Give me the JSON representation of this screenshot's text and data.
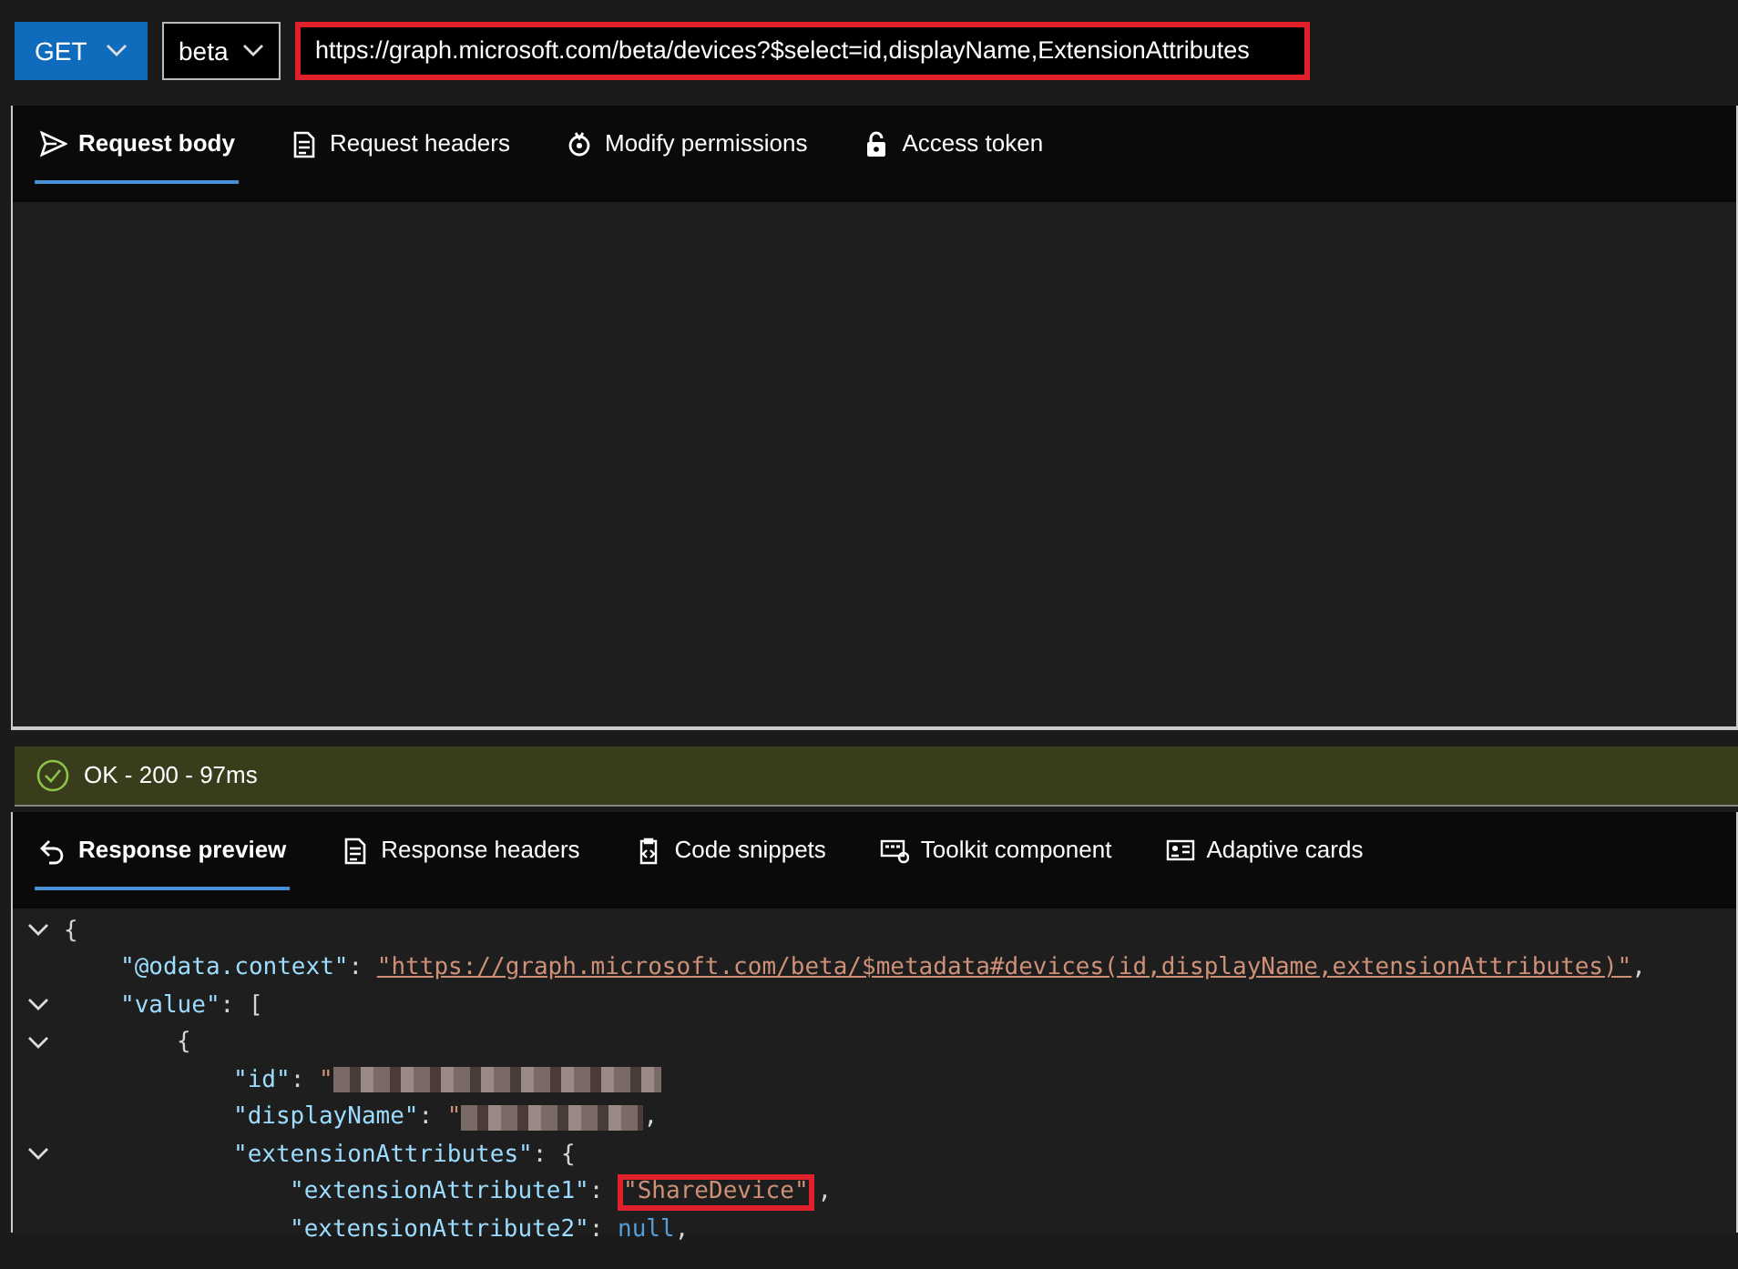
{
  "query_bar": {
    "method": "GET",
    "version": "beta",
    "url": "https://graph.microsoft.com/beta/devices?$select=id,displayName,ExtensionAttributes",
    "url_highlighted": true
  },
  "request_tabs": [
    {
      "label": "Request body",
      "selected": true
    },
    {
      "label": "Request headers",
      "selected": false
    },
    {
      "label": "Modify permissions",
      "selected": false
    },
    {
      "label": "Access token",
      "selected": false
    }
  ],
  "status": {
    "text": "OK - 200 - 97ms",
    "kind": "success"
  },
  "response_tabs": [
    {
      "label": "Response preview",
      "selected": true
    },
    {
      "label": "Response headers",
      "selected": false
    },
    {
      "label": "Code snippets",
      "selected": false
    },
    {
      "label": "Toolkit component",
      "selected": false
    },
    {
      "label": "Adaptive cards",
      "selected": false
    }
  ],
  "response_code": [
    {
      "foldable": true,
      "tokens": [
        {
          "kind": "punct",
          "text": "{"
        }
      ],
      "children": [
        {
          "foldable": false,
          "tokens": [
            {
              "kind": "key",
              "text": "\"@odata.context\""
            },
            {
              "kind": "punct",
              "text": ": "
            },
            {
              "kind": "link",
              "text": "\"https://graph.microsoft.com/beta/$metadata#devices(id,displayName,extensionAttributes)\""
            },
            {
              "kind": "punct",
              "text": ","
            }
          ]
        },
        {
          "foldable": true,
          "tokens": [
            {
              "kind": "key",
              "text": "\"value\""
            },
            {
              "kind": "punct",
              "text": ": ["
            }
          ],
          "children": [
            {
              "foldable": true,
              "tokens": [
                {
                  "kind": "punct",
                  "text": "{"
                }
              ],
              "children": [
                {
                  "foldable": false,
                  "tokens": [
                    {
                      "kind": "key",
                      "text": "\"id\""
                    },
                    {
                      "kind": "punct",
                      "text": ": "
                    },
                    {
                      "kind": "string",
                      "text": "\""
                    },
                    {
                      "kind": "redacted"
                    }
                  ]
                },
                {
                  "foldable": false,
                  "tokens": [
                    {
                      "kind": "key",
                      "text": "\"displayName\""
                    },
                    {
                      "kind": "punct",
                      "text": ": "
                    },
                    {
                      "kind": "string",
                      "text": "\""
                    },
                    {
                      "kind": "redacted"
                    },
                    {
                      "kind": "punct",
                      "text": ","
                    }
                  ]
                },
                {
                  "foldable": true,
                  "tokens": [
                    {
                      "kind": "key",
                      "text": "\"extensionAttributes\""
                    },
                    {
                      "kind": "punct",
                      "text": ": {"
                    }
                  ],
                  "children": [
                    {
                      "foldable": false,
                      "tokens": [
                        {
                          "kind": "key",
                          "text": "\"extensionAttribute1\""
                        },
                        {
                          "kind": "punct",
                          "text": ": "
                        },
                        {
                          "kind": "string",
                          "text": "\"ShareDevice\"",
                          "highlighted": true
                        },
                        {
                          "kind": "punct",
                          "text": ","
                        }
                      ]
                    },
                    {
                      "foldable": false,
                      "tokens": [
                        {
                          "kind": "key",
                          "text": "\"extensionAttribute2\""
                        },
                        {
                          "kind": "punct",
                          "text": ": "
                        },
                        {
                          "kind": "null",
                          "text": "null"
                        },
                        {
                          "kind": "punct",
                          "text": ","
                        }
                      ]
                    }
                  ]
                }
              ]
            }
          ]
        }
      ]
    }
  ]
}
